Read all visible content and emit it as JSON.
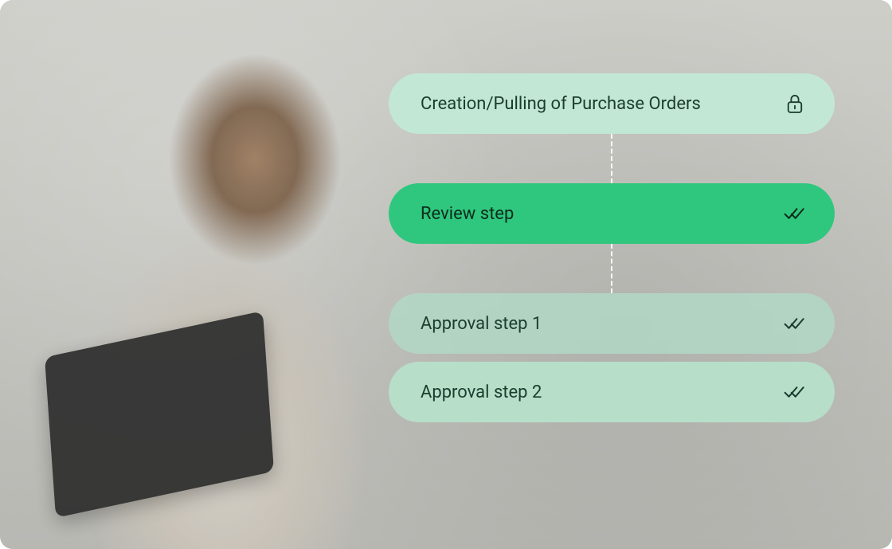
{
  "workflow": {
    "steps": [
      {
        "id": "creation",
        "label": "Creation/Pulling of Purchase Orders",
        "icon": "lock",
        "style": "light",
        "active": false
      },
      {
        "id": "review",
        "label": "Review step",
        "icon": "double-check",
        "style": "accent",
        "active": true
      },
      {
        "id": "approval1",
        "label": "Approval step 1",
        "icon": "double-check",
        "style": "muted",
        "active": false
      },
      {
        "id": "approval2",
        "label": "Approval step 2",
        "icon": "double-check",
        "style": "light",
        "active": false
      }
    ]
  },
  "colors": {
    "step_light": "#c2e8d5",
    "step_accent": "#2ec77d",
    "step_muted": "#b2d9c6",
    "text_dark": "#1a3d2e",
    "connector": "#ffffff"
  }
}
